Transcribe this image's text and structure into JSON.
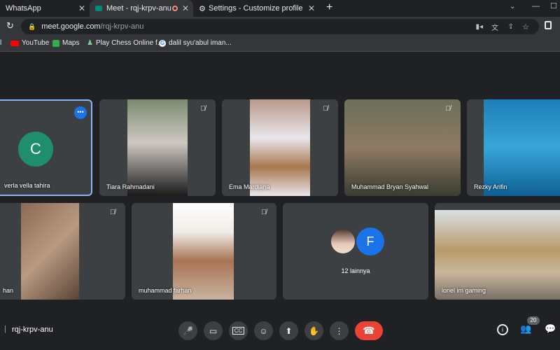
{
  "browser": {
    "tabs": [
      {
        "label": "WhatsApp"
      },
      {
        "label": "Meet - rqj-krpv-anu"
      },
      {
        "label": "Settings - Customize profile"
      }
    ],
    "url_host": "meet.google.com",
    "url_path": "/rqj-krpv-anu",
    "bookmarks": [
      {
        "label": "l"
      },
      {
        "label": "YouTube"
      },
      {
        "label": "Maps"
      },
      {
        "label": "Play Chess Online f..."
      },
      {
        "label": "dalil syu'abul iman..."
      }
    ]
  },
  "meet": {
    "participants": [
      {
        "name": "verla vella tahira",
        "initial": "C"
      },
      {
        "name": "Tiara Rahmadani"
      },
      {
        "name": "Ema Mardiana"
      },
      {
        "name": "Muhammad Bryan Syahwal"
      },
      {
        "name": "Rezky Arifin"
      },
      {
        "name": "han"
      },
      {
        "name": "muhammad farhan"
      },
      {
        "name": "lonel im gaming"
      }
    ],
    "others_label": "12 lainnya",
    "others_initial": "F",
    "meeting_code": "rqj-krpv-anu",
    "people_count": "20"
  },
  "colors": {
    "background": "#202124",
    "tile": "#3c4043",
    "avatar_teal": "#1e8e6e",
    "avatar_blue": "#1a73e8",
    "end_call": "#ea4335"
  }
}
